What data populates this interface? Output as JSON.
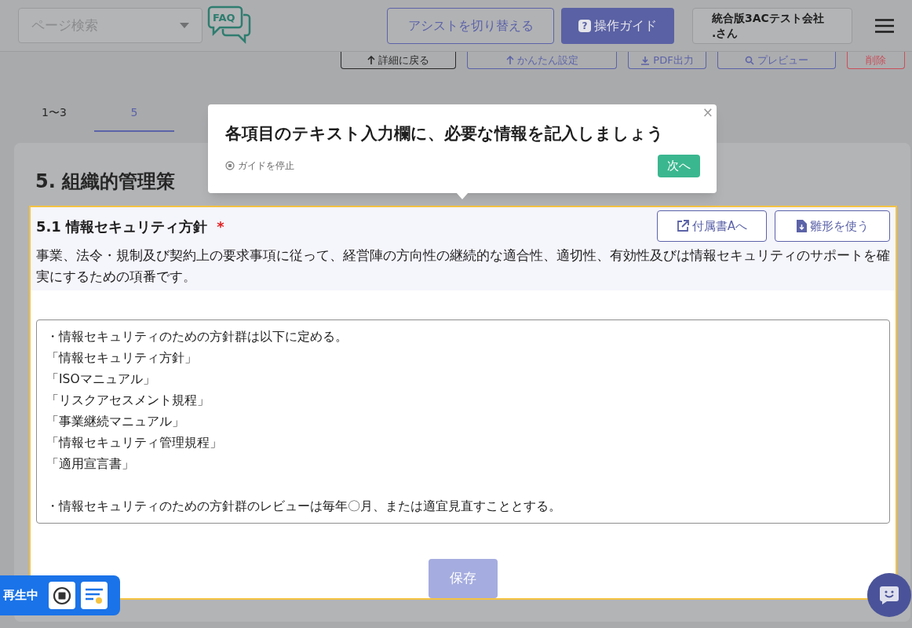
{
  "header": {
    "search": {
      "placeholder": "ページ検索"
    },
    "faq": "FAQ",
    "assist_button": "アシストを切り替える",
    "guide_button": {
      "icon": "?",
      "label": "操作ガイド"
    },
    "user_lines": [
      "統合版3ACテスト会社",
      ".さん"
    ]
  },
  "toolbar": [
    {
      "kind": "back",
      "label": "詳細に戻る"
    },
    {
      "kind": "settings",
      "label": "かんたん設定"
    },
    {
      "kind": "download",
      "label": "PDF出力"
    },
    {
      "kind": "preview",
      "label": "プレビュー"
    },
    {
      "kind": "danger",
      "label": "削除"
    }
  ],
  "tabs": [
    {
      "label": "1〜3",
      "selected": false
    },
    {
      "label": "5",
      "selected": true
    }
  ],
  "section_title": "5. 組織的管理策",
  "item": {
    "title": "5.1 情報セキュリティ方針",
    "required_mark": "*",
    "buttons": [
      {
        "kind": "link",
        "label": "付属書Aへ"
      },
      {
        "kind": "template",
        "label": "雛形を使う"
      }
    ],
    "description": "事業、法令・規制及び契約上の要求事項に従って、経営陣の方向性の継続的な適合性、適切性、有効性及びは情報セキュリティのサポートを確実にするための項番です。",
    "paragraphs": [
      [
        "・情報セキュリティのための方針群は以下に定める。",
        "「情報セキュリティ方針」",
        "「ISOマニュアル」",
        "「リスクアセスメント規程」",
        "「事業継続マニュアル」",
        "「情報セキュリティ管理規程」",
        "「適用宣言書」"
      ],
      [
        "・情報セキュリティのための方針群のレビューは毎年〇月、または適宜見直すこととする。"
      ]
    ],
    "save": "保存"
  },
  "guide_popup": {
    "close": "×",
    "message": "各項目のテキスト入力欄に、必要な情報を記入しましょう",
    "stop": "ガイドを停止",
    "next": "次へ"
  },
  "player": {
    "status": "再生中"
  }
}
